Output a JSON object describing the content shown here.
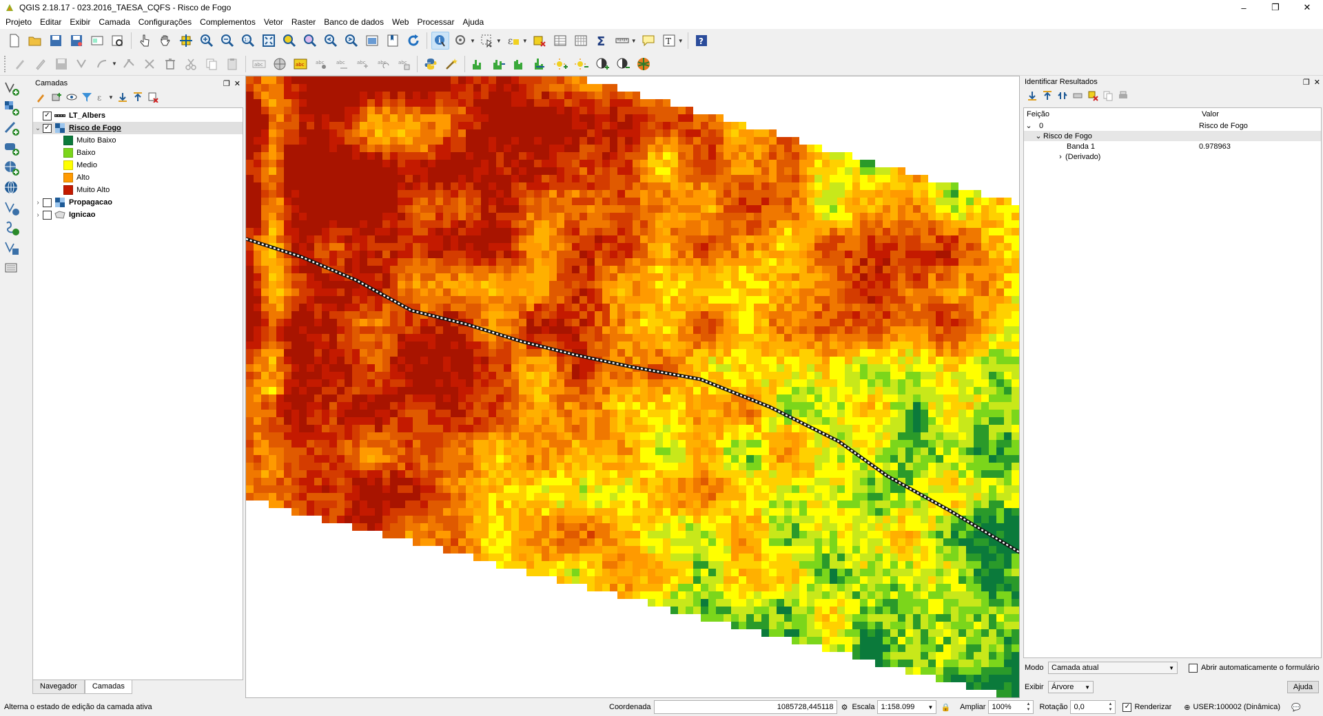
{
  "window": {
    "title": "QGIS 2.18.17 - 023.2016_TAESA_CQFS - Risco de Fogo",
    "controls": [
      "–",
      "❐",
      "✕"
    ]
  },
  "menu": [
    "Projeto",
    "Editar",
    "Exibir",
    "Camada",
    "Configurações",
    "Complementos",
    "Vetor",
    "Raster",
    "Banco de dados",
    "Web",
    "Processar",
    "Ajuda"
  ],
  "layers_panel": {
    "title": "Camadas",
    "layers": [
      {
        "name": "LT_Albers",
        "checked": true,
        "expanded": false,
        "icon": "line-layer-icon"
      },
      {
        "name": "Risco de Fogo",
        "checked": true,
        "expanded": true,
        "icon": "raster-layer-icon"
      },
      {
        "name": "Propagacao",
        "checked": false,
        "expanded": false,
        "icon": "raster-layer-icon"
      },
      {
        "name": "Ignicao",
        "checked": false,
        "expanded": false,
        "icon": "polygon-layer-icon"
      }
    ],
    "legend": [
      {
        "label": "Muito Baixo",
        "color": "#0b7a3b"
      },
      {
        "label": "Baixo",
        "color": "#7bd61b"
      },
      {
        "label": "Medio",
        "color": "#ffff00"
      },
      {
        "label": "Alto",
        "color": "#ff9a00"
      },
      {
        "label": "Muito Alto",
        "color": "#c41a00"
      }
    ],
    "tabs": [
      "Navegador",
      "Camadas"
    ],
    "active_tab": "Camadas"
  },
  "identify_panel": {
    "title": "Identificar Resultados",
    "columns": [
      "Feição",
      "Valor"
    ],
    "rows": {
      "root_feature": "0",
      "root_value": "Risco de Fogo",
      "layer": "Risco de Fogo",
      "band_label": "Banda 1",
      "band_value": "0.978963",
      "derived": "(Derivado)"
    },
    "mode_label": "Modo",
    "mode_value": "Camada atual",
    "auto_open_label": "Abrir automaticamente o formulário",
    "view_label": "Exibir",
    "view_value": "Árvore",
    "help_button": "Ajuda"
  },
  "statusbar": {
    "message": "Alterna o estado de edição da camada ativa",
    "coord_label": "Coordenada",
    "coord_value": "1085728,445118",
    "scale_label": "Escala",
    "scale_value": "1:158.099",
    "magnify_label": "Ampliar",
    "magnify_value": "100%",
    "rotation_label": "Rotação",
    "rotation_value": "0,0",
    "render_label": "Renderizar",
    "render_checked": true,
    "crs": "USER:100002 (Dinâmica)"
  },
  "colors": {
    "muito_alto": "#c41a00",
    "alto": "#ff9a00",
    "medio": "#ffff00",
    "baixo": "#7bd61b",
    "muito_baixo": "#0b7a3b",
    "selection": "#cce4f7"
  }
}
